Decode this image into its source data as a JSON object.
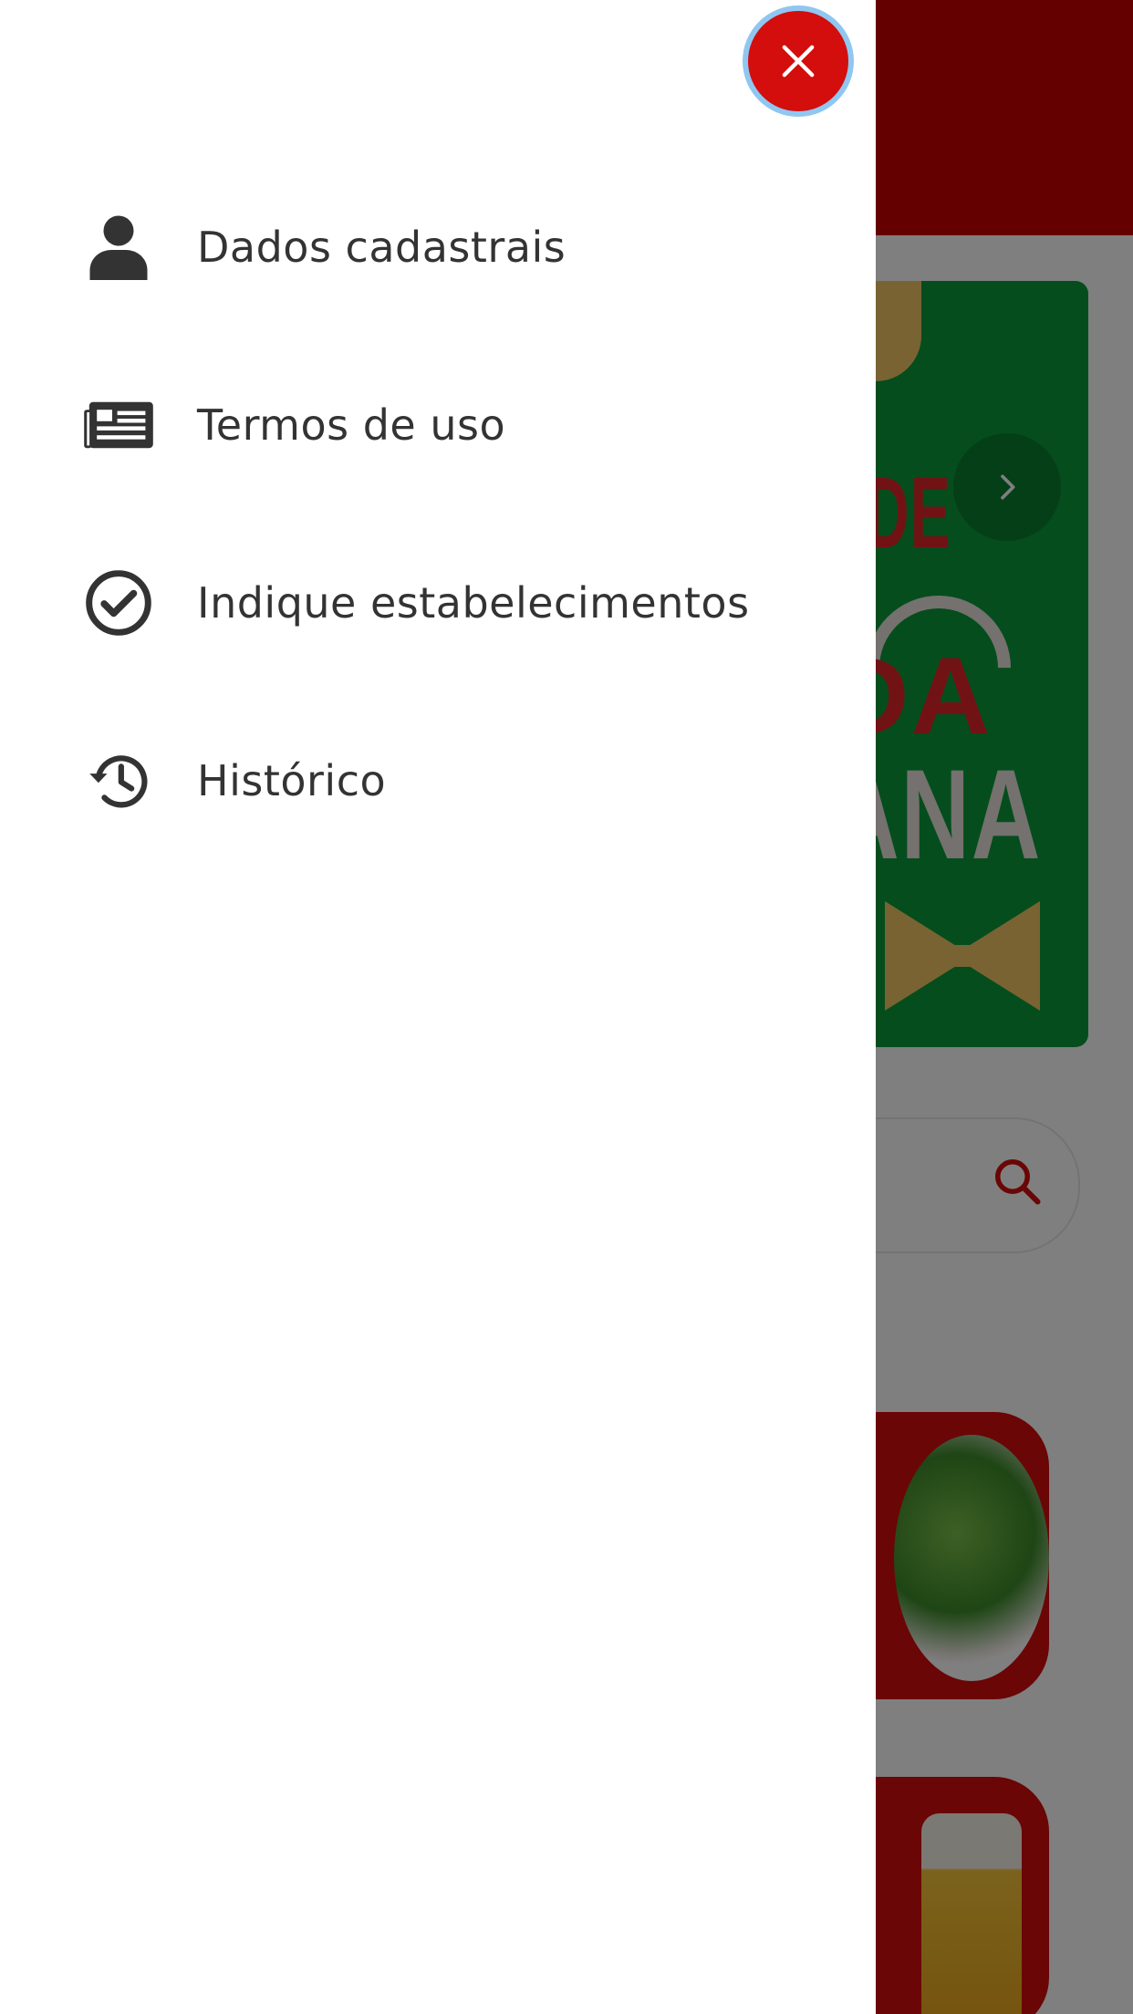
{
  "drawer": {
    "close_icon": "close-icon",
    "items": [
      {
        "label": "Dados cadastrais",
        "icon": "person-icon"
      },
      {
        "label": "Termos de uso",
        "icon": "newspaper-icon"
      },
      {
        "label": "Indique estabelecimentos",
        "icon": "check-circle-icon"
      },
      {
        "label": "Histórico",
        "icon": "history-icon"
      }
    ]
  },
  "colors": {
    "accent": "#d40d0d",
    "header": "#c80000",
    "banner": "#0a9a3a",
    "text": "#333333",
    "focus_ring": "#8fc7f0"
  }
}
